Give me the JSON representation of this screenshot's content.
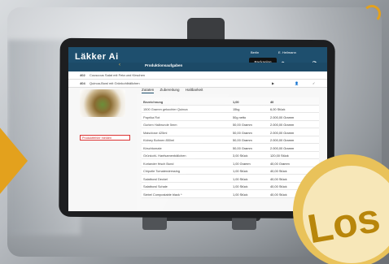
{
  "header": {
    "app_title": "Läkker Ai",
    "section": "Produktionsaufgaben",
    "location": "Berlin",
    "user": "E. Heilmann",
    "mode": "Packaging",
    "time": "11:05"
  },
  "orders": [
    {
      "id": "402",
      "text": "Couscous Salat mit Feta und Kirschen"
    },
    {
      "id": "404",
      "text": "Quinoa-Bowl mit Grünkohlbällchen"
    }
  ],
  "tabs": [
    "Zutaten",
    "Zubereitung",
    "Haltbarkeit"
  ],
  "problem_label": "Produktfehler melden",
  "table": {
    "headers": [
      "Bezeichnung",
      "1,00",
      "40"
    ],
    "rows": [
      [
        "1500 Gramm gekochter Quinoa",
        "15kg",
        "6,00 Stück"
      ],
      [
        "Paprika Rot",
        "50g netto",
        "2.000,00 Gramm"
      ],
      [
        "Gurken Halbrunde 5mm",
        "50,00 Gramm",
        "2.000,00 Gramm"
      ],
      [
        "Mais/dose 425ml",
        "50,00 Gramm",
        "2.000,00 Gramm"
      ],
      [
        "Kidney Bohnen 850ml",
        "50,00 Gramm",
        "2.000,00 Gramm"
      ],
      [
        "Kirschtomate",
        "50,00 Gramm",
        "2.000,00 Gramm"
      ],
      [
        "Grünkohl- Hanfsamenbällchen",
        "3,00 Stück",
        "120,00 Stück"
      ],
      [
        "Koriander frisch Bund",
        "1,00 Gramm",
        "40,00 Gramm"
      ],
      [
        "Chipotle Tomatendressing",
        "1,00 Stück",
        "40,00 Stück"
      ],
      [
        "Salatbowl Deckel",
        "1,00 Stück",
        "40,00 Stück"
      ],
      [
        "Salatbowl Schale",
        "1,00 Stück",
        "40,00 Stück"
      ],
      [
        "Siebel Compostable black *",
        "1,00 Stück",
        "40,00 Stück"
      ]
    ]
  },
  "badge_text": "Los"
}
